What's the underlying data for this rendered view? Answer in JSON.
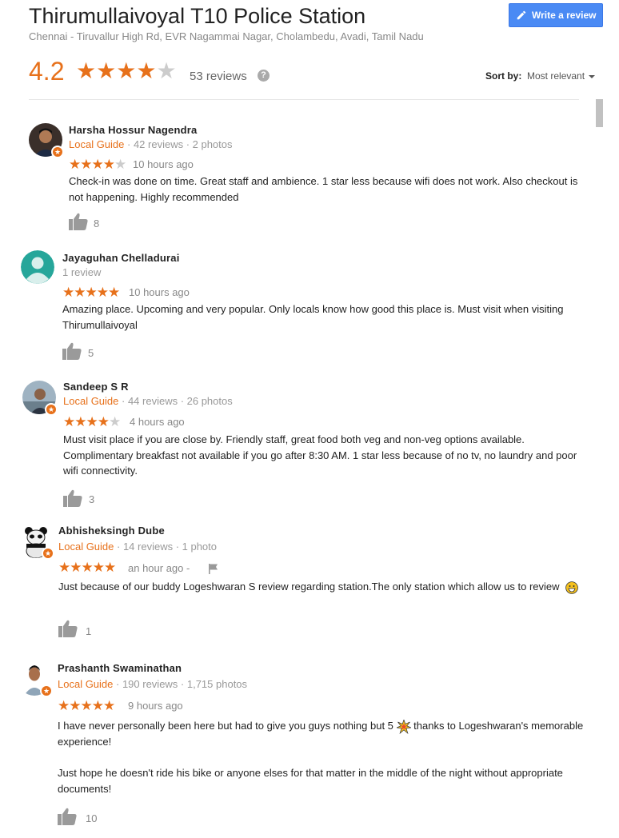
{
  "place": {
    "title": "Thirumullaivoyal T10 Police Station",
    "address": "Chennai - Tiruvallur High Rd, EVR Nagammai Nagar, Cholambedu, Avadi, Tamil Nadu",
    "write_review_label": "Write a review",
    "rating": "4.2",
    "rating_stars": 4.2,
    "reviews_count": "53 reviews",
    "sort_by_label": "Sort by:",
    "sort_by_value": "Most relevant",
    "accent_color": "#e7711b",
    "button_color": "#4a8af4"
  },
  "reviews": [
    {
      "name": "Harsha Hossur Nagendra",
      "local_guide": "Local Guide",
      "meta": " · 42 reviews · 2 photos",
      "stars": 4,
      "time": "10 hours ago",
      "text": [
        "Check-in was done on time. Great staff and ambience. 1 star less because wifi does not work. Also checkout is not happening. Highly recommended"
      ],
      "likes": "8",
      "avatar": "photo-avatar"
    },
    {
      "name": "Jayaguhan Chelladurai",
      "local_guide": "",
      "meta": "1 review",
      "stars": 5,
      "time": "10 hours ago",
      "text": [
        "Amazing place. Upcoming and very popular. Only locals know how good this place is. Must visit when visiting Thirumullaivoyal"
      ],
      "likes": "5",
      "avatar": "default-person-avatar"
    },
    {
      "name": "Sandeep S R",
      "local_guide": "Local Guide",
      "meta": " · 44 reviews · 26 photos",
      "stars": 4,
      "time": "4 hours ago",
      "text": [
        "Must visit place if you are close by. Friendly staff, great food both veg and non-veg options available. Complimentary breakfast not available if you go after 8:30 AM. 1 star less because of no tv, no laundry and poor wifi connectivity."
      ],
      "likes": "3",
      "avatar": "photo-avatar"
    },
    {
      "name": "Abhisheksingh Dube",
      "local_guide": "Local Guide",
      "meta": " · 14 reviews · 1 photo",
      "stars": 5,
      "time": "an hour ago",
      "time_suffix": " -",
      "text_before_emoji": "Just because of our buddy    Logeshwaran S review regarding station.The only station which allow us to review",
      "likes": "1",
      "avatar": "panda-avatar"
    },
    {
      "name": "Prashanth Swaminathan",
      "local_guide": "Local Guide",
      "meta": " · 190 reviews · 1,715 photos",
      "stars": 5,
      "time": "9 hours ago",
      "text_part1_before_emoji": "I have never personally been here but had to give you guys nothing but 5",
      "text_part1_after_emoji": " thanks to Logeshwaran's memorable experience!",
      "text_part2": "Just hope he doesn't ride his bike or anyone elses for that matter in the middle of the night without appropriate documents!",
      "likes": "10",
      "avatar": "photo-avatar"
    }
  ]
}
